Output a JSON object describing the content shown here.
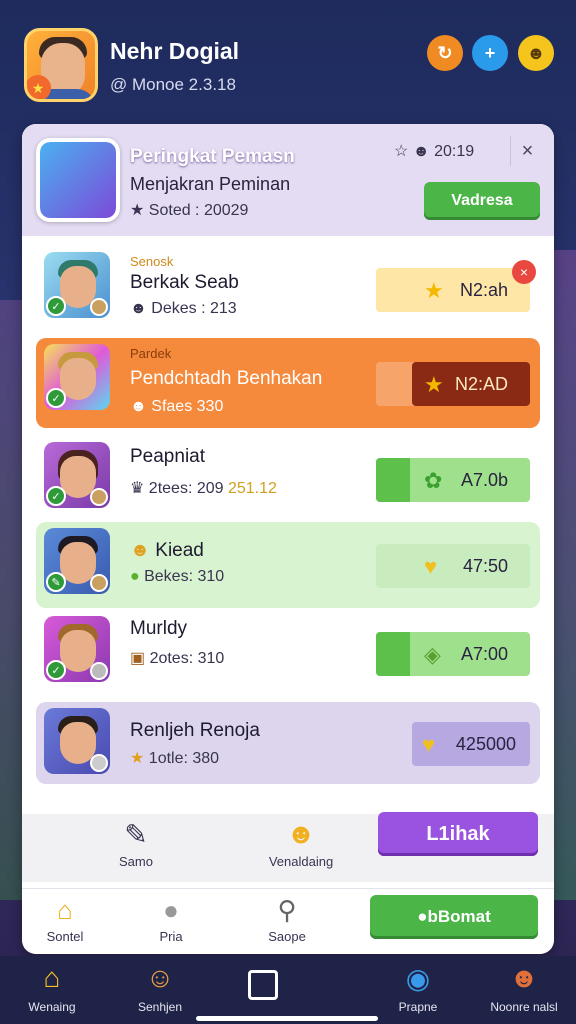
{
  "header": {
    "username": "Nehr Dogial",
    "user_stat": "@ Monoe 2.3.18",
    "icons": [
      "refresh-icon",
      "plus-icon",
      "smiley-icon"
    ]
  },
  "panel": {
    "title": "Peringkat Pemasn",
    "subtitle": "Menjakran Peminan",
    "score": "Soted : 20029",
    "time": "20:19",
    "button": "Vadresa",
    "close": "×"
  },
  "rows": [
    {
      "small": "Senosk",
      "name": "Berkak Seab",
      "score": "Dekes : 213",
      "value": "N2:ah"
    },
    {
      "small": "Pardek",
      "name": "Pendchtadh Benhakan",
      "score": "Sfaes 330",
      "value": "N2:AD"
    },
    {
      "small": "",
      "name": "Peapniat",
      "score": "2tees: 209",
      "extra": "251.12",
      "value": "A7.0b"
    },
    {
      "small": "",
      "name": "Kiead",
      "score": "Bekes: 310",
      "value": "47:50"
    },
    {
      "small": "",
      "name": "Murldy",
      "score": "2otes: 310",
      "value": "A7:00"
    },
    {
      "small": "",
      "name": "Renljeh Renoja",
      "score": "1otle: 380",
      "value": "425000"
    }
  ],
  "actions": {
    "left_label": "Samo",
    "mid_label": "Venaldaing",
    "button": "L1ihak"
  },
  "nav2": {
    "items": [
      "Sontel",
      "Pria",
      "Saope"
    ],
    "button": "bBomat"
  },
  "global_nav": {
    "items": [
      "Wenaing",
      "Senhjen",
      "Prapne",
      "Noonre nalsl"
    ]
  }
}
